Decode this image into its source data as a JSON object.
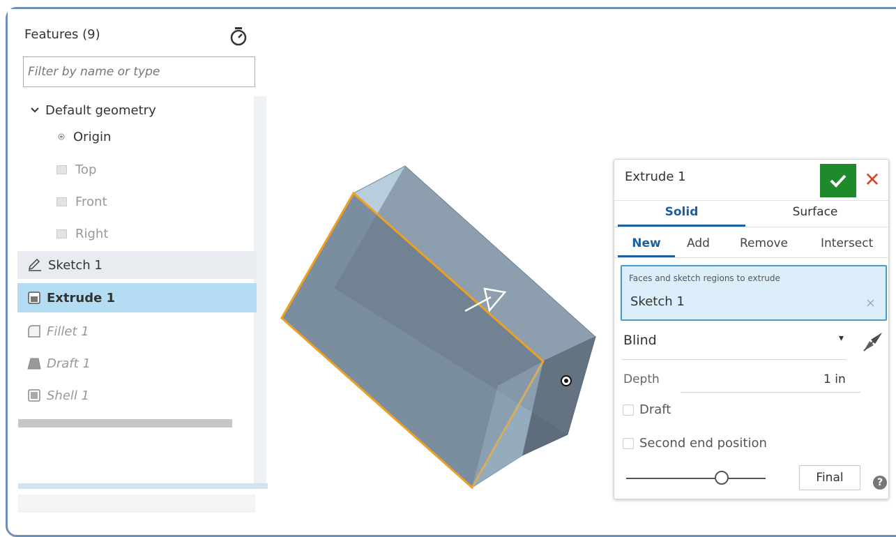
{
  "features": {
    "header": "Features (9)",
    "filter_placeholder": "Filter by name or type",
    "default_geometry": "Default geometry",
    "origin": "Origin",
    "planes": [
      "Top",
      "Front",
      "Right"
    ],
    "items": [
      {
        "label": "Sketch 1",
        "icon": "pencil-icon",
        "state": "normal"
      },
      {
        "label": "Extrude 1",
        "icon": "extrude-icon",
        "state": "selected"
      },
      {
        "label": "Fillet 1",
        "icon": "fillet-icon",
        "state": "rolled-back"
      },
      {
        "label": "Draft 1",
        "icon": "draft-icon",
        "state": "rolled-back"
      },
      {
        "label": "Shell 1",
        "icon": "shell-icon",
        "state": "rolled-back"
      }
    ]
  },
  "dialog": {
    "title": "Extrude 1",
    "tabs_type": [
      "Solid",
      "Surface"
    ],
    "tabs_op": [
      "New",
      "Add",
      "Remove",
      "Intersect"
    ],
    "selection_label": "Faces and sketch regions to extrude",
    "selection_value": "Sketch 1",
    "clear_symbol": "×",
    "end_type": "Blind",
    "depth_label": "Depth",
    "depth_value": "1 in",
    "draft_label": "Draft",
    "second_end_label": "Second end position",
    "final_label": "Final",
    "help_symbol": "?",
    "cancel_symbol": "✕"
  },
  "colors": {
    "accent": "#1b5f9e",
    "ok_green": "#1f8a2b",
    "cancel_red": "#d9472b",
    "selection_highlight": "#b4dcf2",
    "sketch_edge": "#f0a020"
  }
}
